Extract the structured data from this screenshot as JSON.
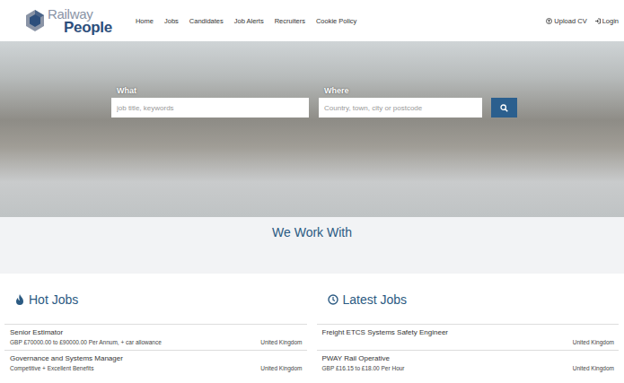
{
  "logo": {
    "line1": "Railway",
    "line2": "People"
  },
  "nav": [
    {
      "label": "Home",
      "selected": false
    },
    {
      "label": "Jobs",
      "selected": false
    },
    {
      "label": "Candidates",
      "selected": false
    },
    {
      "label": "Job Alerts",
      "selected": false
    },
    {
      "label": "Recruiters",
      "selected": false
    },
    {
      "label": "Cookie Policy",
      "selected": false
    }
  ],
  "account": {
    "upload": "Upload CV",
    "login": "Login"
  },
  "search": {
    "what_label": "What",
    "what_placeholder": "job title, keywords",
    "where_label": "Where",
    "where_placeholder": "Country, town, city or postcode"
  },
  "partners": {
    "title": "We Work With"
  },
  "hot_jobs": {
    "title": "Hot Jobs",
    "jobs": [
      {
        "title": "Senior Estimator",
        "salary": "GBP £70000.00 to £90000.00 Per Annum, + car allowance",
        "location": "United Kingdom"
      },
      {
        "title": "Governance and Systems Manager",
        "salary": "Competitive + Excellent Benefits",
        "location": "United Kingdom"
      }
    ]
  },
  "latest_jobs": {
    "title": "Latest Jobs",
    "jobs": [
      {
        "title": "Freight ETCS Systems Safety Engineer",
        "salary": "",
        "location": "United Kingdom"
      },
      {
        "title": "PWAY Rail Operative",
        "salary": "GBP £16.15 to £18.00 Per Hour",
        "location": "United Kingdom"
      }
    ]
  }
}
